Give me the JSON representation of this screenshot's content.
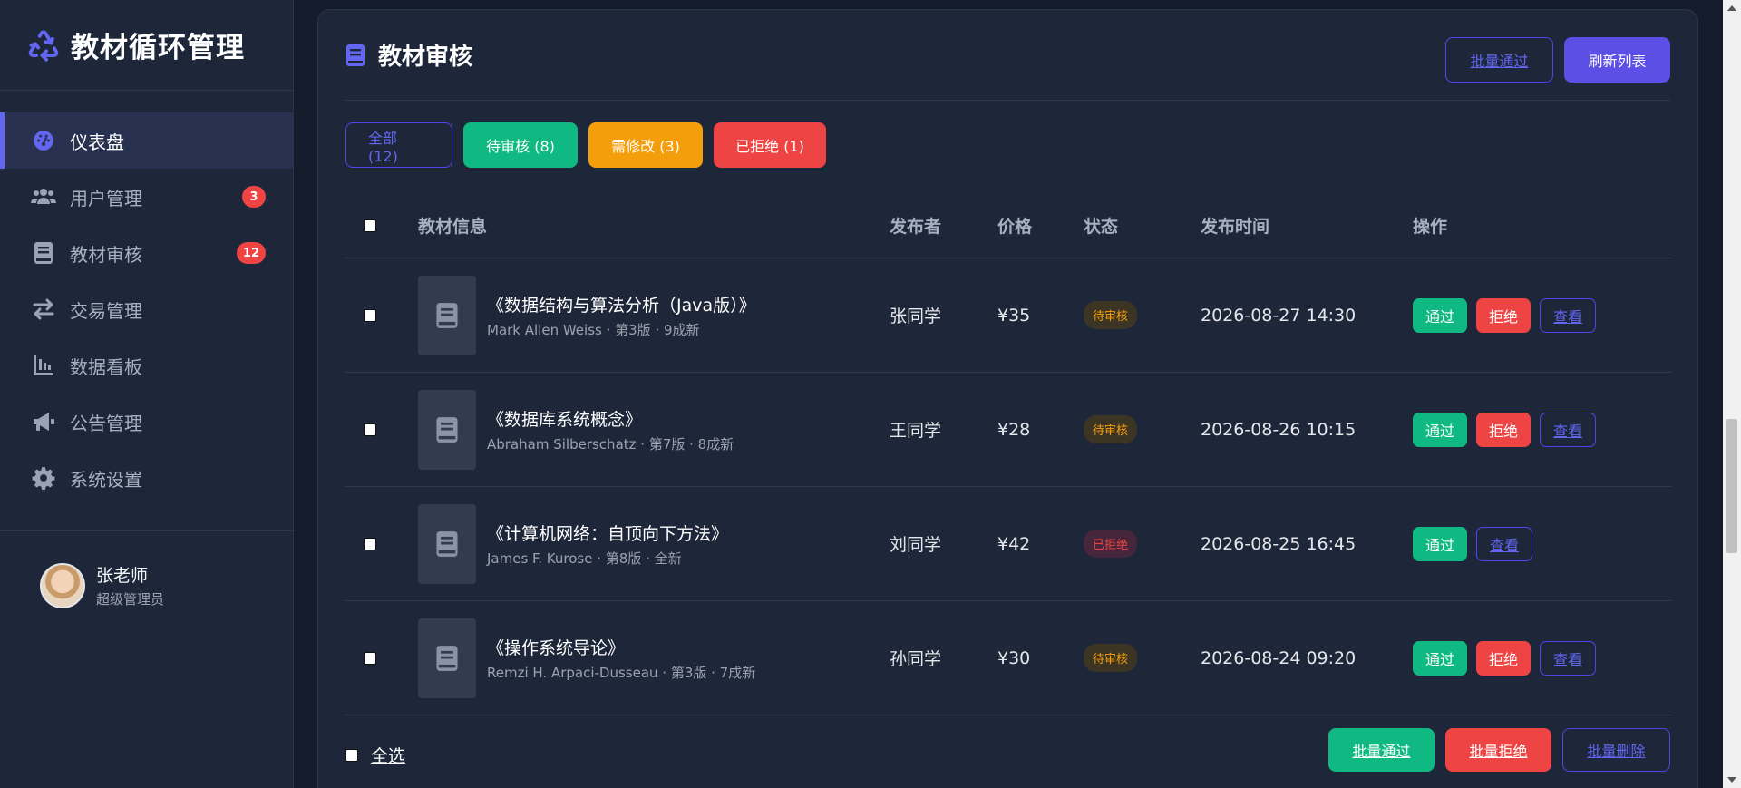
{
  "brand": {
    "title": "教材循环管理",
    "icon": "recycle-icon"
  },
  "sidebar": {
    "items": [
      {
        "label": "仪表盘",
        "icon": "dashboard-icon",
        "active": true,
        "count": ""
      },
      {
        "label": "用户管理",
        "icon": "users-icon",
        "active": false,
        "count": "3"
      },
      {
        "label": "教材审核",
        "icon": "book-icon",
        "active": false,
        "count": "12"
      },
      {
        "label": "交易管理",
        "icon": "exchange-icon",
        "active": false,
        "count": ""
      },
      {
        "label": "数据看板",
        "icon": "chart-icon",
        "active": false,
        "count": ""
      },
      {
        "label": "公告管理",
        "icon": "megaphone-icon",
        "active": false,
        "count": ""
      },
      {
        "label": "系统设置",
        "icon": "gear-icon",
        "active": false,
        "count": ""
      }
    ]
  },
  "user": {
    "name": "张老师",
    "role": "超级管理员"
  },
  "card": {
    "title": "教材审核",
    "batch_approve": "批量通过",
    "refresh": "刷新列表"
  },
  "filters": {
    "all": "全部 (12)",
    "pending": "待审核 (8)",
    "revise": "需修改 (3)",
    "rejected": "已拒绝 (1)"
  },
  "table": {
    "headers": {
      "info": "教材信息",
      "publisher": "发布者",
      "price": "价格",
      "status": "状态",
      "time": "发布时间",
      "actions": "操作"
    },
    "rows": [
      {
        "title": "《数据结构与算法分析（Java版）》",
        "meta": "Mark Allen Weiss · 第3版 · 9成新",
        "publisher": "张同学",
        "price": "¥35",
        "status": "待审核",
        "status_kind": "pending",
        "time": "2026-08-27 14:30"
      },
      {
        "title": "《数据库系统概念》",
        "meta": "Abraham Silberschatz · 第7版 · 8成新",
        "publisher": "王同学",
        "price": "¥28",
        "status": "待审核",
        "status_kind": "pending",
        "time": "2026-08-26 10:15"
      },
      {
        "title": "《计算机网络：自顶向下方法》",
        "meta": "James F. Kurose · 第8版 · 全新",
        "publisher": "刘同学",
        "price": "¥42",
        "status": "已拒绝",
        "status_kind": "rejected",
        "time": "2026-08-25 16:45"
      },
      {
        "title": "《操作系统导论》",
        "meta": "Remzi H. Arpaci-Dusseau · 第3版 · 7成新",
        "publisher": "孙同学",
        "price": "¥30",
        "status": "待审核",
        "status_kind": "pending",
        "time": "2026-08-24 09:20"
      }
    ],
    "actions": {
      "approve": "通过",
      "reject": "拒绝",
      "view": "查看"
    }
  },
  "footer": {
    "select_all": "全选",
    "batch_approve": "批量通过",
    "batch_reject": "批量拒绝",
    "batch_delete": "批量删除"
  },
  "colors": {
    "accent": "#5b4fe6",
    "success": "#10b981",
    "danger": "#ef4444",
    "warning": "#f59e0b"
  }
}
